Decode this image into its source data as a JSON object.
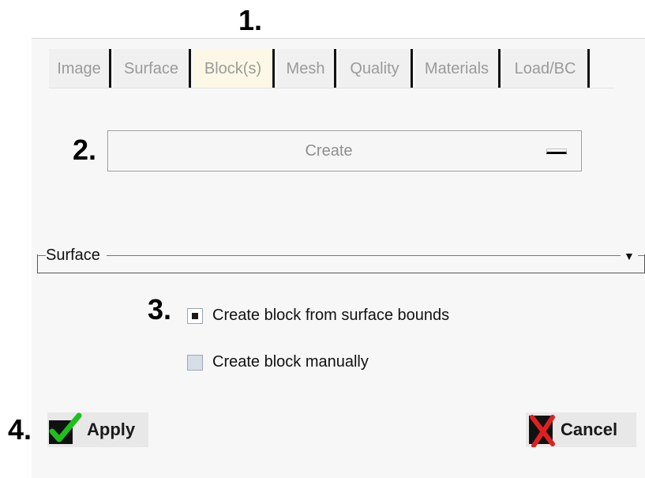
{
  "steps": {
    "s1": "1.",
    "s2": "2.",
    "s3": "3.",
    "s4": "4."
  },
  "tabs": [
    {
      "label": "Image",
      "active": false
    },
    {
      "label": "Surface",
      "active": false
    },
    {
      "label": "Block(s)",
      "active": true
    },
    {
      "label": "Mesh",
      "active": false
    },
    {
      "label": "Quality",
      "active": false
    },
    {
      "label": "Materials",
      "active": false
    },
    {
      "label": "Load/BC",
      "active": false
    }
  ],
  "create_field": {
    "label": "Create"
  },
  "group": {
    "label": "Surface",
    "arrow": "▼"
  },
  "options": [
    {
      "label": "Create block from surface bounds",
      "checked": true
    },
    {
      "label": "Create block manually",
      "checked": false
    }
  ],
  "buttons": {
    "apply": "Apply",
    "cancel": "Cancel"
  },
  "colors": {
    "check_green": "#1fbf1f",
    "cancel_red": "#e02020",
    "active_tab": "#fdf8e6"
  }
}
